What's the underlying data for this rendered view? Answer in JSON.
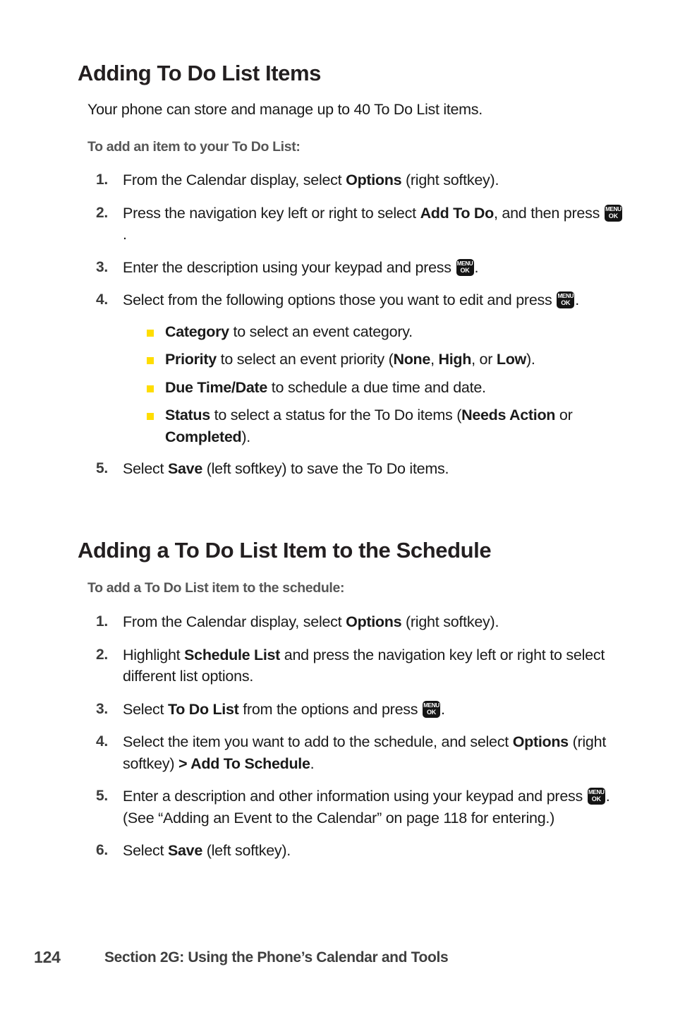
{
  "page": {
    "number": "124",
    "section_footer": "Section 2G: Using the Phone’s Calendar and Tools",
    "bullet_color": "#FFDD00",
    "heading_color": "#231f20",
    "subheading_color": "#565656"
  },
  "section1": {
    "heading": "Adding To Do List Items",
    "intro": "Your phone can store and manage up to 40 To Do List items.",
    "subheading": "To add an item to your To Do List:",
    "steps": [
      {
        "num": "1.",
        "parts": [
          {
            "t": "From the Calendar display, select ",
            "b": false
          },
          {
            "t": "Options",
            "b": true
          },
          {
            "t": " (right softkey).",
            "b": false
          }
        ]
      },
      {
        "num": "2.",
        "parts": [
          {
            "t": "Press the navigation key left or right to select ",
            "b": false
          },
          {
            "t": "Add To Do",
            "b": true
          },
          {
            "t": ", and then  press ",
            "b": false
          },
          {
            "t": "[MENU/OK]",
            "b": false,
            "key": true
          },
          {
            "t": ".",
            "b": false
          }
        ]
      },
      {
        "num": "3.",
        "parts": [
          {
            "t": "Enter the description using your keypad and press ",
            "b": false
          },
          {
            "t": "[MENU/OK]",
            "b": false,
            "key": true
          },
          {
            "t": ".",
            "b": false
          }
        ]
      },
      {
        "num": "4.",
        "parts": [
          {
            "t": "Select from the following options those you want to edit and press ",
            "b": false
          },
          {
            "t": "[MENU/OK]",
            "b": false,
            "key": true
          },
          {
            "t": ".",
            "b": false
          }
        ]
      },
      {
        "num": "5.",
        "parts": [
          {
            "t": "Select ",
            "b": false
          },
          {
            "t": "Save",
            "b": true
          },
          {
            "t": " (left softkey) to save the To Do items.",
            "b": false
          }
        ]
      }
    ],
    "bullets": [
      {
        "parts": [
          {
            "t": "Category",
            "b": true
          },
          {
            "t": " to select an event category.",
            "b": false
          }
        ]
      },
      {
        "parts": [
          {
            "t": "Priority",
            "b": true
          },
          {
            "t": " to select an event priority (",
            "b": false
          },
          {
            "t": "None",
            "b": true
          },
          {
            "t": ", ",
            "b": false
          },
          {
            "t": "High",
            "b": true
          },
          {
            "t": ", or ",
            "b": false
          },
          {
            "t": "Low",
            "b": true
          },
          {
            "t": ").",
            "b": false
          }
        ]
      },
      {
        "parts": [
          {
            "t": "Due Time/Date",
            "b": true
          },
          {
            "t": " to schedule a due time and date.",
            "b": false
          }
        ]
      },
      {
        "parts": [
          {
            "t": "Status",
            "b": true
          },
          {
            "t": " to select a status for the To Do items (",
            "b": false
          },
          {
            "t": "Needs Action",
            "b": true
          },
          {
            "t": " or ",
            "b": false
          },
          {
            "t": "Completed",
            "b": true
          },
          {
            "t": ").",
            "b": false
          }
        ]
      }
    ]
  },
  "section2": {
    "heading": "Adding a To Do List Item to the Schedule",
    "subheading": "To add a To Do List item to the schedule:",
    "steps": [
      {
        "num": "1.",
        "parts": [
          {
            "t": "From the Calendar display, select ",
            "b": false
          },
          {
            "t": "Options",
            "b": true
          },
          {
            "t": " (right softkey).",
            "b": false
          }
        ]
      },
      {
        "num": "2.",
        "parts": [
          {
            "t": "Highlight ",
            "b": false
          },
          {
            "t": "Schedule List",
            "b": true
          },
          {
            "t": " and press the navigation key left or right  to select different list options.",
            "b": false
          }
        ]
      },
      {
        "num": "3.",
        "parts": [
          {
            "t": "Select ",
            "b": false
          },
          {
            "t": "To Do List",
            "b": true
          },
          {
            "t": " from the options and press ",
            "b": false
          },
          {
            "t": "[MENU/OK]",
            "b": false,
            "key": true
          },
          {
            "t": ".",
            "b": false
          }
        ]
      },
      {
        "num": "4.",
        "parts": [
          {
            "t": "Select the item you want to add to the schedule, and select ",
            "b": false
          },
          {
            "t": "Options",
            "b": true
          },
          {
            "t": " (right softkey) ",
            "b": false
          },
          {
            "t": "> Add To Schedule",
            "b": true
          },
          {
            "t": ".",
            "b": false
          }
        ]
      },
      {
        "num": "5.",
        "parts": [
          {
            "t": "Enter a description and other information using your keypad and press ",
            "b": false
          },
          {
            "t": "[MENU/OK]",
            "b": false,
            "key": true
          },
          {
            "t": ". (See “Adding an Event to the Calendar” on page 118 for entering.)",
            "b": false
          }
        ]
      },
      {
        "num": "6.",
        "parts": [
          {
            "t": "Select ",
            "b": false
          },
          {
            "t": "Save",
            "b": true
          },
          {
            "t": " (left softkey).",
            "b": false
          }
        ]
      }
    ]
  },
  "icons": {
    "menu_ok_top": "MENU",
    "menu_ok_bottom": "OK"
  }
}
